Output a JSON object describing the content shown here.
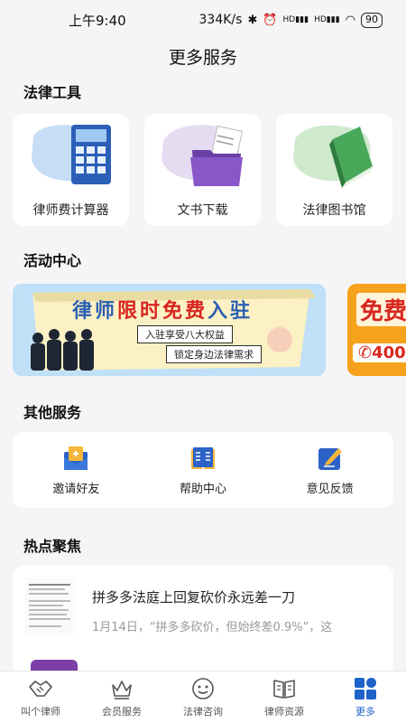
{
  "status_bar": {
    "time": "上午9:40",
    "speed": "334K/s",
    "network_label_1": "HD",
    "network_label_2": "HD",
    "battery": "90",
    "icons": [
      "bluetooth-icon",
      "alarm-icon",
      "signal-icon",
      "signal-icon",
      "wifi-icon",
      "battery-icon"
    ]
  },
  "header": {
    "title": "更多服务"
  },
  "legal_tools": {
    "title": "法律工具",
    "items": [
      {
        "label": "律师费计算器",
        "icon": "calculator-icon"
      },
      {
        "label": "文书下载",
        "icon": "folder-document-icon"
      },
      {
        "label": "法律图书馆",
        "icon": "book-icon"
      }
    ]
  },
  "activity": {
    "title": "活动中心",
    "banner": {
      "headline_a": "律师",
      "headline_b": "限时免费",
      "headline_c": "入驻",
      "line1": "入驻享受八大权益",
      "line2": "锁定身边法律需求"
    },
    "banner2": {
      "text": "免费",
      "phone_text": "400"
    }
  },
  "other_services": {
    "title": "其他服务",
    "items": [
      {
        "label": "邀请好友",
        "icon": "invite-envelope-icon"
      },
      {
        "label": "帮助中心",
        "icon": "help-book-icon"
      },
      {
        "label": "意见反馈",
        "icon": "feedback-edit-icon"
      }
    ]
  },
  "hot_topics": {
    "title": "热点聚焦",
    "items": [
      {
        "title": "拼多多法庭上回复砍价永远差一刀",
        "desc": "1月14日，“拼多多砍价，但始终差0.9%”，这"
      }
    ]
  },
  "tabbar": {
    "items": [
      {
        "label": "叫个律师",
        "icon": "handshake-icon",
        "active": false
      },
      {
        "label": "会员服务",
        "icon": "crown-icon",
        "active": false
      },
      {
        "label": "法律咨询",
        "icon": "smile-face-icon",
        "active": false
      },
      {
        "label": "律师资源",
        "icon": "open-book-icon",
        "active": false
      },
      {
        "label": "更多",
        "icon": "grid-more-icon",
        "active": true
      }
    ]
  },
  "colors": {
    "accent": "#1d63c9",
    "background": "#f5f5f7",
    "banner_bg": "#bfe0f7",
    "banner2_bg": "#f7a21d"
  }
}
